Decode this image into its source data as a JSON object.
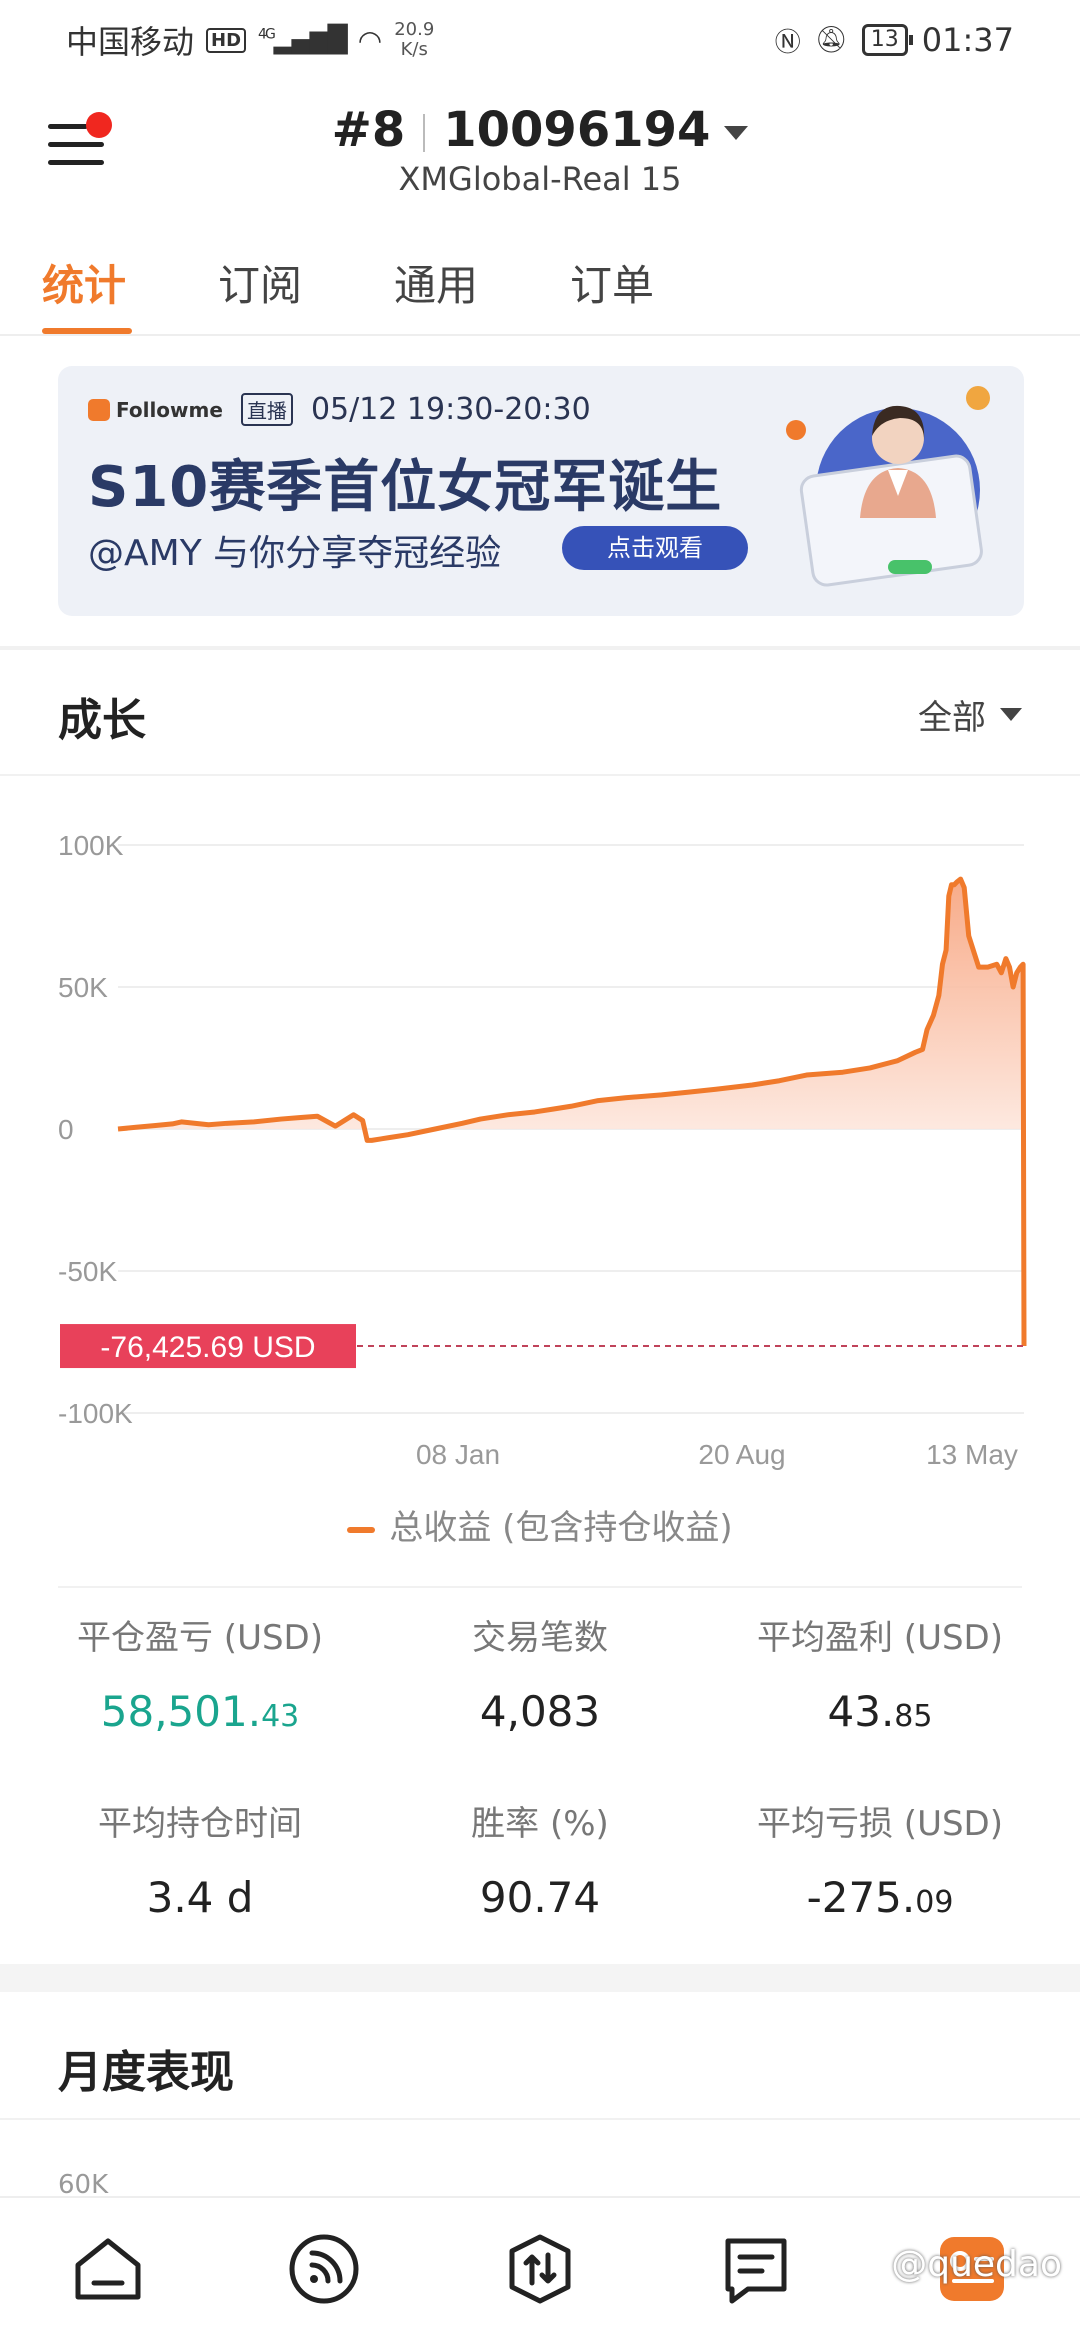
{
  "status_bar": {
    "carrier": "中国移动",
    "hd": "HD",
    "network": "4G",
    "speed_value": "20.9",
    "speed_unit": "K/s",
    "battery": "13",
    "time": "01:37"
  },
  "header": {
    "rank": "#8",
    "account": "10096194",
    "server": "XMGlobal-Real 15"
  },
  "tabs": [
    {
      "label": "统计",
      "active": true
    },
    {
      "label": "订阅",
      "active": false
    },
    {
      "label": "通用",
      "active": false
    },
    {
      "label": "订单",
      "active": false
    }
  ],
  "banner": {
    "brand": "Followme",
    "live": "直播",
    "datetime": "05/12  19:30-20:30",
    "title": "S10赛季首位女冠军诞生",
    "subtitle": "@AMY 与你分享夺冠经验",
    "button": "点击观看"
  },
  "growth": {
    "title": "成长",
    "range": "全部",
    "legend": "总收益 (包含持仓收益)"
  },
  "chart_data": {
    "type": "area",
    "y_ticks": [
      "100K",
      "50K",
      "0",
      "-50K",
      "-100K"
    ],
    "ylim": [
      -100000,
      100000
    ],
    "x_ticks": [
      "08 Jan",
      "20 Aug",
      "13 May"
    ],
    "current_value_label": "-76,425.69 USD",
    "current_value": -76425.69,
    "series": [
      {
        "name": "总收益 (包含持仓收益)",
        "color": "#f07a2c",
        "x": [
          0,
          2,
          4,
          6,
          7,
          10,
          12,
          15,
          18,
          20,
          22,
          24,
          26,
          27,
          27.5,
          28,
          30,
          32,
          35,
          38,
          40,
          43,
          46,
          48,
          50,
          53,
          56,
          60,
          63,
          66,
          70,
          73,
          76,
          80,
          83,
          86,
          88,
          88.8,
          89.3,
          90,
          90.6,
          91,
          91.4,
          91.7,
          92,
          92.3,
          92.6,
          93,
          93.4,
          93.9,
          95,
          96,
          97,
          97.5,
          98,
          98.4,
          98.8,
          99.2,
          99.6,
          99.9,
          100
        ],
        "y": [
          0,
          600,
          1200,
          1800,
          2500,
          1500,
          2000,
          2500,
          3500,
          4000,
          4500,
          1000,
          5000,
          3000,
          -4000,
          -4000,
          -3000,
          -2000,
          0,
          2000,
          3500,
          5000,
          6000,
          7000,
          8000,
          10000,
          11000,
          12000,
          13000,
          14000,
          15500,
          17000,
          19000,
          20000,
          21500,
          24000,
          27000,
          28000,
          35000,
          40000,
          47000,
          58000,
          63000,
          82000,
          86000,
          86000,
          87000,
          88000,
          85000,
          68000,
          57000,
          57000,
          58000,
          55000,
          60000,
          57000,
          50000,
          55000,
          57000,
          58000,
          -76425.69
        ]
      }
    ],
    "grid": true,
    "fill_color": "#fbd3c1"
  },
  "stats": {
    "row1": [
      {
        "label": "平仓盈亏 (USD)",
        "int": "58,501.",
        "dec": "43",
        "green": true
      },
      {
        "label": "交易笔数",
        "int": "4,083",
        "dec": "",
        "green": false
      },
      {
        "label": "平均盈利 (USD)",
        "int": "43.",
        "dec": "85",
        "green": false
      }
    ],
    "row2": [
      {
        "label": "平均持仓时间",
        "int": "3.4 d",
        "dec": "",
        "green": false
      },
      {
        "label": "胜率 (%)",
        "int": "90.74",
        "dec": "",
        "green": false
      },
      {
        "label": "平均亏损 (USD)",
        "int": "-275.",
        "dec": "09",
        "green": false
      }
    ]
  },
  "monthly": {
    "title": "月度表现",
    "axis_top": "60K"
  },
  "bottom_nav": [
    "home-icon",
    "feed-icon",
    "trade-icon",
    "notes-icon",
    "profile-icon"
  ],
  "watermark": "@quedao",
  "colors": {
    "accent": "#f07a2c",
    "green": "#1aa58e",
    "danger": "#e8415a",
    "banner_button": "#3652b8"
  }
}
